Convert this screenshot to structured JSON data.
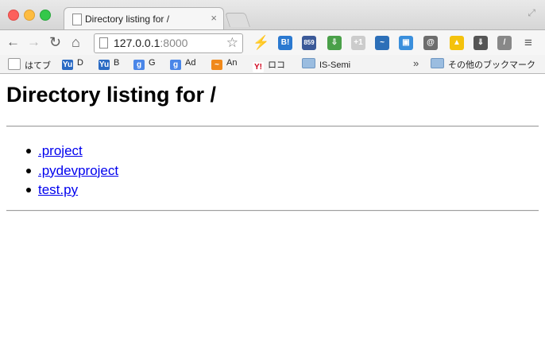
{
  "browser": {
    "tab_title": "Directory listing for /",
    "tab_close": "×",
    "address_host": "127.0.0.1",
    "address_port": ":8000",
    "bookmarks": [
      "はてブ",
      "D",
      "B",
      "G",
      "Ad",
      "An",
      "ロコ",
      "IS-Semi"
    ],
    "bookmark_other": "その他のブックマーク",
    "extension_badge": "859",
    "colors": {
      "link": "#0000ee",
      "bookmark_folder": "#9bbde0"
    }
  },
  "page": {
    "title": "Directory listing for /",
    "files": [
      ".project",
      ".pydevproject",
      "test.py"
    ]
  }
}
